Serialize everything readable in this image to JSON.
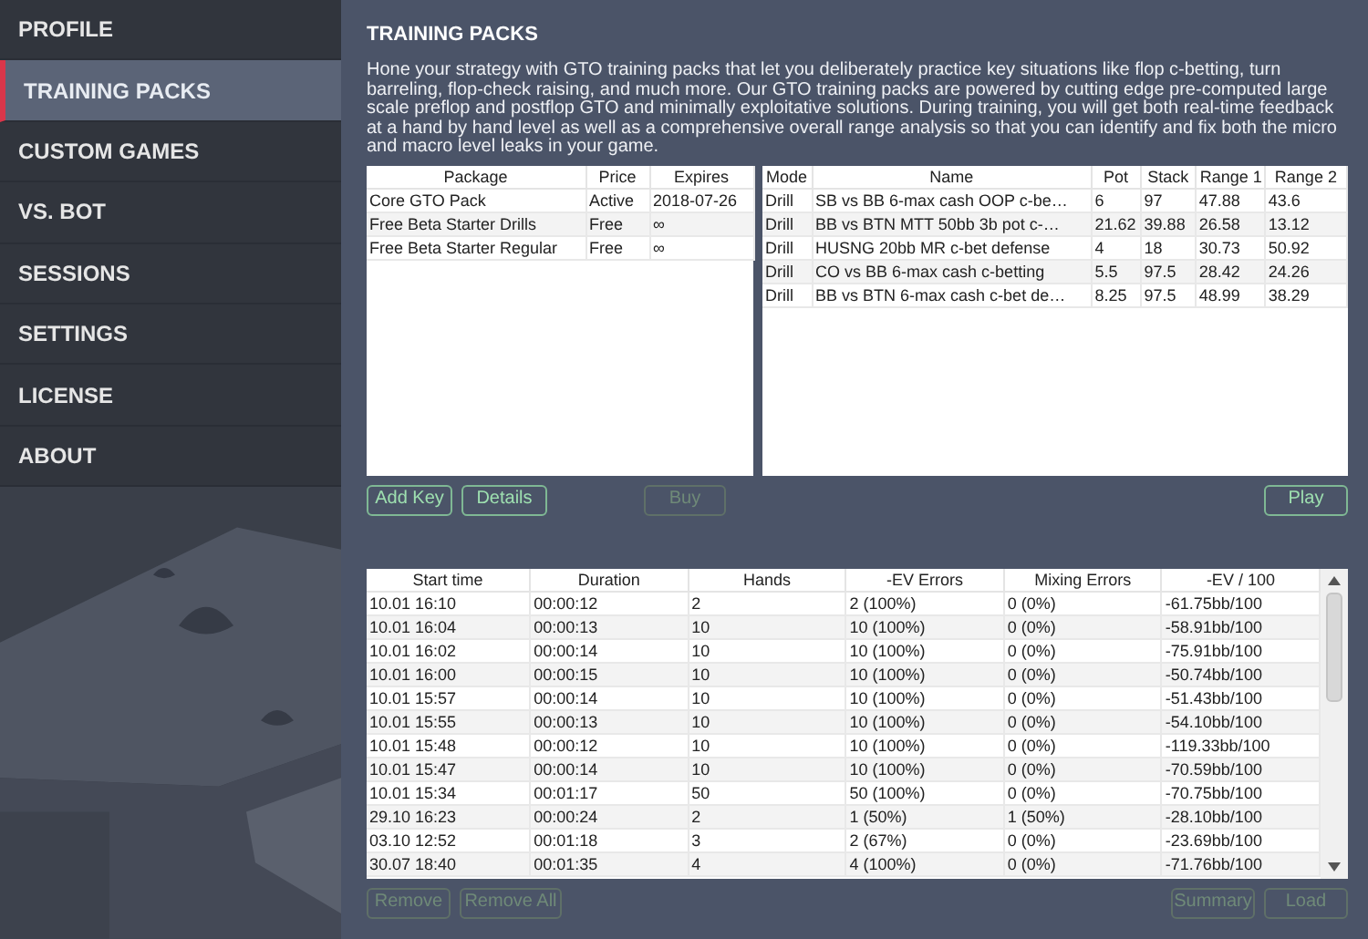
{
  "sidebar": {
    "items": [
      {
        "label": "PROFILE",
        "selected": false
      },
      {
        "label": "TRAINING PACKS",
        "selected": true
      },
      {
        "label": "CUSTOM GAMES",
        "selected": false
      },
      {
        "label": "VS. BOT",
        "selected": false
      },
      {
        "label": "SESSIONS",
        "selected": false
      },
      {
        "label": "SETTINGS",
        "selected": false
      },
      {
        "label": "LICENSE",
        "selected": false
      },
      {
        "label": "ABOUT",
        "selected": false
      }
    ]
  },
  "title": "TRAINING PACKS",
  "description": "Hone your strategy with GTO training packs that let you deliberately practice key situations like flop c-betting, turn barreling, flop-check raising, and much more.  Our GTO training packs are powered by cutting edge pre-computed large scale preflop and postflop GTO and minimally exploitative solutions. During training, you will get both real-time feedback at a hand by hand level as well as a comprehensive overall range analysis so that you can identify and fix both the micro and macro level leaks in your game.",
  "packages": {
    "columns": [
      "Package",
      "Price",
      "Expires"
    ],
    "rows": [
      [
        "Core GTO Pack",
        "Active",
        "2018-07-26"
      ],
      [
        "Free Beta Starter Drills",
        "Free",
        "∞"
      ],
      [
        "Free Beta Starter Regular",
        "Free",
        "∞"
      ]
    ]
  },
  "drills": {
    "columns": [
      "Mode",
      "Name",
      "Pot",
      "Stack",
      "Range 1",
      "Range 2"
    ],
    "rows": [
      [
        "Drill",
        "SB vs BB 6-max cash OOP c-be…",
        "6",
        "97",
        "47.88",
        "43.6"
      ],
      [
        "Drill",
        "BB vs BTN MTT 50bb 3b pot c-…",
        "21.62",
        "39.88",
        "26.58",
        "13.12"
      ],
      [
        "Drill",
        "HUSNG 20bb MR c-bet defense",
        "4",
        "18",
        "30.73",
        "50.92"
      ],
      [
        "Drill",
        "CO vs BB 6-max cash c-betting",
        "5.5",
        "97.5",
        "28.42",
        "24.26"
      ],
      [
        "Drill",
        "BB vs BTN 6-max cash c-bet de…",
        "8.25",
        "97.5",
        "48.99",
        "38.29"
      ]
    ]
  },
  "pack_buttons_left": [
    {
      "label": "Add Key",
      "disabled": false
    },
    {
      "label": "Details",
      "disabled": false
    },
    {
      "label": "Buy",
      "disabled": true
    }
  ],
  "pack_buttons_right": [
    {
      "label": "Play",
      "disabled": false
    }
  ],
  "sessions": {
    "columns": [
      "Start time",
      "Duration",
      "Hands",
      "-EV Errors",
      "Mixing Errors",
      "-EV / 100"
    ],
    "rows": [
      [
        "10.01 16:10",
        "00:00:12",
        "2",
        "2 (100%)",
        "0 (0%)",
        "-61.75bb/100"
      ],
      [
        "10.01 16:04",
        "00:00:13",
        "10",
        "10 (100%)",
        "0 (0%)",
        "-58.91bb/100"
      ],
      [
        "10.01 16:02",
        "00:00:14",
        "10",
        "10 (100%)",
        "0 (0%)",
        "-75.91bb/100"
      ],
      [
        "10.01 16:00",
        "00:00:15",
        "10",
        "10 (100%)",
        "0 (0%)",
        "-50.74bb/100"
      ],
      [
        "10.01 15:57",
        "00:00:14",
        "10",
        "10 (100%)",
        "0 (0%)",
        "-51.43bb/100"
      ],
      [
        "10.01 15:55",
        "00:00:13",
        "10",
        "10 (100%)",
        "0 (0%)",
        "-54.10bb/100"
      ],
      [
        "10.01 15:48",
        "00:00:12",
        "10",
        "10 (100%)",
        "0 (0%)",
        "-119.33bb/100"
      ],
      [
        "10.01 15:47",
        "00:00:14",
        "10",
        "10 (100%)",
        "0 (0%)",
        "-70.59bb/100"
      ],
      [
        "10.01 15:34",
        "00:01:17",
        "50",
        "50 (100%)",
        "0 (0%)",
        "-70.75bb/100"
      ],
      [
        "29.10 16:23",
        "00:00:24",
        "2",
        "1 (50%)",
        "1 (50%)",
        "-28.10bb/100"
      ],
      [
        "03.10 12:52",
        "00:01:18",
        "3",
        "2 (67%)",
        "0 (0%)",
        "-23.69bb/100"
      ],
      [
        "30.07 18:40",
        "00:01:35",
        "4",
        "4 (100%)",
        "0 (0%)",
        "-71.76bb/100"
      ]
    ]
  },
  "session_buttons_left": [
    {
      "label": "Remove",
      "disabled": true
    },
    {
      "label": "Remove All",
      "disabled": true
    }
  ],
  "session_buttons_right": [
    {
      "label": "Summary",
      "disabled": true
    },
    {
      "label": "Load",
      "disabled": true
    }
  ]
}
